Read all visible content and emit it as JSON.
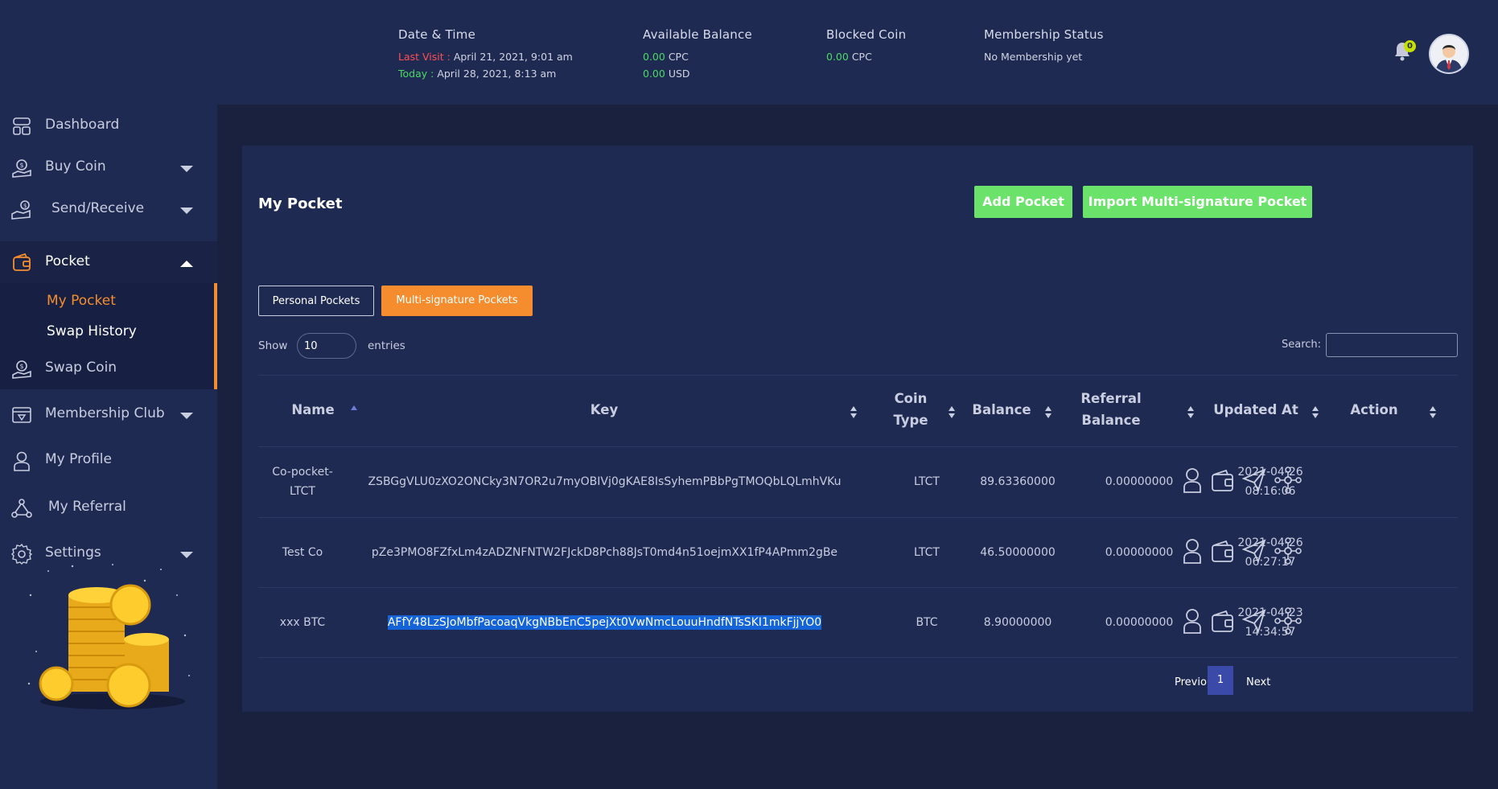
{
  "header": {
    "datetime": {
      "title": "Date & Time",
      "last_visit_label": "Last Visit :",
      "last_visit_value": " April 21, 2021, 9:01 am",
      "today_label": "Today :",
      "today_value": " April 28, 2021, 8:13 am"
    },
    "available_balance": {
      "title": "Available Balance",
      "cpc_amount": "0.00",
      "cpc_unit": " CPC",
      "usd_amount": "0.00",
      "usd_unit": " USD"
    },
    "blocked_coin": {
      "title": "Blocked Coin",
      "amount": "0.00",
      "unit": " CPC"
    },
    "membership": {
      "title": "Membership Status",
      "value": "No Membership yet"
    },
    "notifications_count": "0"
  },
  "sidebar": {
    "items": [
      {
        "label": "Dashboard",
        "icon": "dashboard-icon"
      },
      {
        "label": "Buy Coin",
        "icon": "buy-coin-icon"
      },
      {
        "label": "Send/Receive",
        "icon": "send-receive-icon"
      },
      {
        "label": "Pocket",
        "icon": "pocket-icon"
      },
      {
        "label": "Swap Coin",
        "icon": "swap-coin-icon"
      },
      {
        "label": "Membership Club",
        "icon": "membership-icon"
      },
      {
        "label": "My Profile",
        "icon": "user-icon"
      },
      {
        "label": "My Referral",
        "icon": "referral-icon"
      },
      {
        "label": "Settings",
        "icon": "gear-icon"
      }
    ],
    "pocket_submenu": [
      {
        "label": "My Pocket"
      },
      {
        "label": "Swap History"
      }
    ]
  },
  "main": {
    "title": "My Pocket",
    "add_pocket": "Add Pocket",
    "import_pocket": "Import Multi-signature Pocket",
    "tabs": {
      "personal": "Personal Pockets",
      "multi": "Multi-signature Pockets"
    },
    "show_label": "Show",
    "entries_value": "10",
    "entries_label": "entries",
    "search_label": "Search:",
    "columns": {
      "name": "Name",
      "key": "Key",
      "coin_type_1": "Coin",
      "coin_type_2": "Type",
      "balance": "Balance",
      "referral_1": "Referral",
      "referral_2": "Balance",
      "updated_at": "Updated At",
      "action": "Action"
    },
    "rows": [
      {
        "name_1": "Co-pocket-",
        "name_2": "LTCT",
        "key": "ZSBGgVLU0zXO2ONCky3N7OR2u7myOBIVj0gKAE8IsSyhemPBbPgTMOQbLQLmhVKu",
        "coin": "LTCT",
        "balance": "89.63360000",
        "referral": "0.00000000",
        "date": "2021-04-26",
        "time": "08:16:06"
      },
      {
        "name_1": "Test Co",
        "name_2": "",
        "key": "pZe3PMO8FZfxLm4zADZNFNTW2FJckD8Pch88JsT0md4n51oejmXX1fP4APmm2gBe",
        "coin": "LTCT",
        "balance": "46.50000000",
        "referral": "0.00000000",
        "date": "2021-04-26",
        "time": "06:27:17"
      },
      {
        "name_1": "xxx BTC",
        "name_2": "",
        "key": "AFfY48LzSJoMbfPacoaqVkgNBbEnC5pejXt0VwNmcLouuHndfNTsSKI1mkFjjYO0",
        "coin": "BTC",
        "balance": "8.90000000",
        "referral": "0.00000000",
        "date": "2021-04-23",
        "time": "14:34:57"
      }
    ],
    "pager": {
      "previous": "Previous",
      "page": "1",
      "next": "Next"
    }
  },
  "colors": {
    "accent_orange": "#f58d2f",
    "button_green": "#6be36b",
    "background": "#1b2447",
    "selection_blue": "#1464d8"
  }
}
